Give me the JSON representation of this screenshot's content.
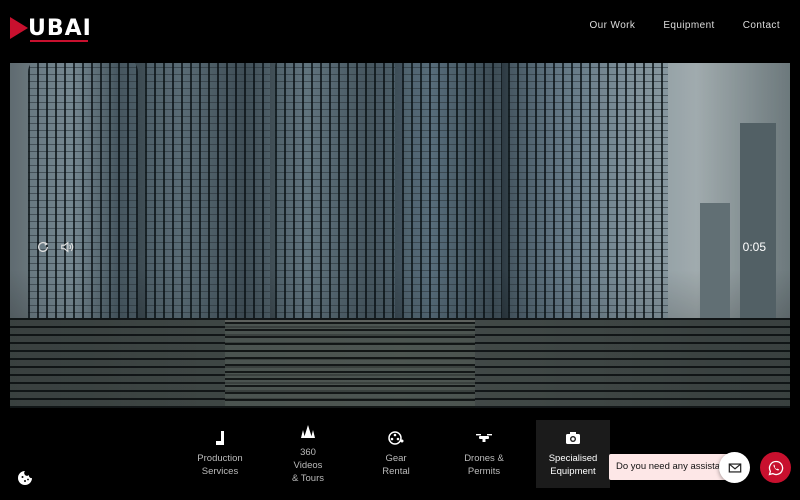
{
  "brand": {
    "logo_text": "UBAI",
    "accent_color": "#c8102e"
  },
  "nav": {
    "items": [
      {
        "label": "Our Work"
      },
      {
        "label": "Equipment"
      },
      {
        "label": "Contact"
      }
    ]
  },
  "video": {
    "time": "0:05",
    "controls": {
      "replay_icon": "replay-icon",
      "volume_icon": "volume-icon"
    }
  },
  "categories": [
    {
      "label_lines": [
        "Production",
        "Services"
      ],
      "icon": "clapper-icon"
    },
    {
      "label_lines": [
        "360",
        "Videos",
        "& Tours"
      ],
      "icon": "sail-icon"
    },
    {
      "label_lines": [
        "Gear",
        "Rental"
      ],
      "icon": "film-reel-icon"
    },
    {
      "label_lines": [
        "Drones &",
        "Permits"
      ],
      "icon": "drone-icon"
    },
    {
      "label_lines": [
        "Specialised",
        "Equipment"
      ],
      "icon": "camera-icon",
      "active": true
    }
  ],
  "chat": {
    "prompt": "Do you need any assistance?",
    "bubble_color": "#fde7e7",
    "whatsapp_color": "#c8102e"
  }
}
